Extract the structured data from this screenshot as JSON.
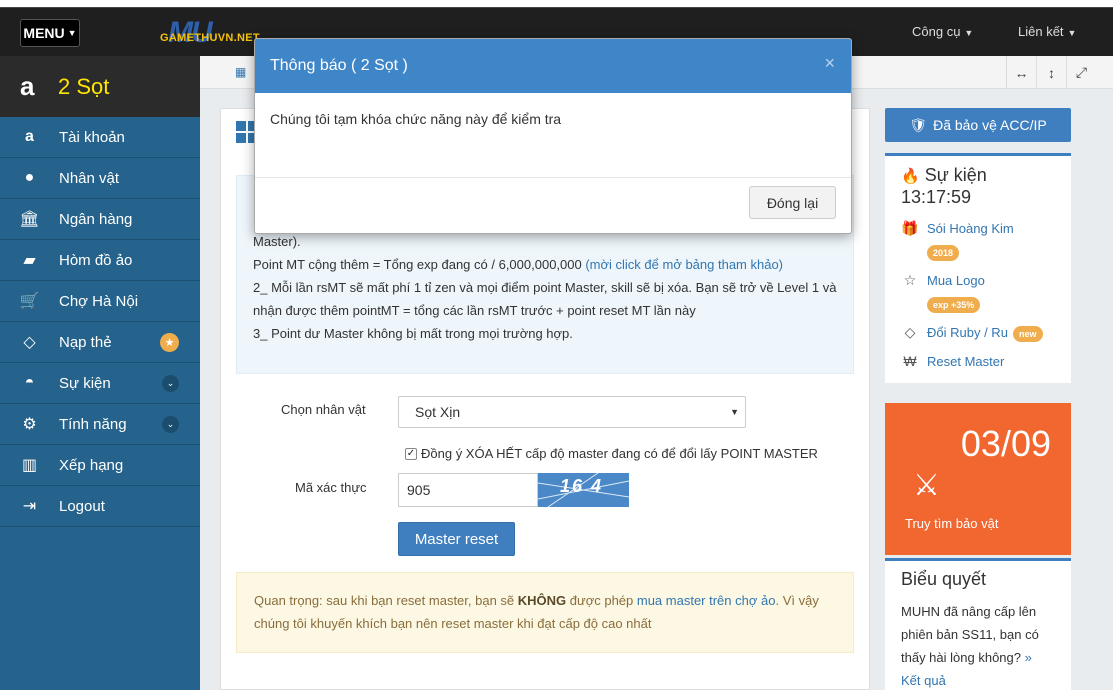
{
  "topbar": {
    "menu_label": "MENU",
    "logo_big": "MU",
    "logo_small": "GAMETHUVN.NET",
    "links": [
      {
        "label": "Công cụ"
      },
      {
        "label": "Liên kết"
      }
    ]
  },
  "sidebar": {
    "username": "2 Sọt",
    "items": [
      {
        "label": "Tài khoản",
        "icon": "amazon-icon"
      },
      {
        "label": "Nhân vật",
        "icon": "user-icon"
      },
      {
        "label": "Ngân hàng",
        "icon": "bank-icon"
      },
      {
        "label": "Hòm đồ ảo",
        "icon": "briefcase-icon"
      },
      {
        "label": "Chợ Hà Nội",
        "icon": "cart-icon"
      },
      {
        "label": "Nạp thẻ",
        "icon": "diamond-icon"
      },
      {
        "label": "Sự kiện",
        "icon": "android-icon"
      },
      {
        "label": "Tính năng",
        "icon": "gears-icon"
      },
      {
        "label": "Xếp hạng",
        "icon": "bar-chart-icon"
      },
      {
        "label": "Logout",
        "icon": "logout-icon"
      }
    ]
  },
  "main": {
    "info": {
      "line1": "Master).",
      "line2_text": "Point MT cộng thêm = Tổng exp đang có / 6,000,000,000 ",
      "line2_link": "(mời click để mở bảng tham khảo)",
      "line3": "2_ Mỗi lần rsMT sẽ mất phí 1 tỉ zen và mọi điểm point Master, skill sẽ bị xóa. Bạn sẽ trở về Level 1 và nhận được thêm pointMT = tổng các lần rsMT trước + point reset MT lần này",
      "line4": "3_ Point dư Master không bị mất trong mọi trường hợp."
    },
    "form": {
      "char_label": "Chọn nhân vật",
      "char_value": "Sọt Xịn",
      "agree_text": "Đồng ý XÓA HẾT cấp độ master đang có để đổi lấy POINT MASTER",
      "captcha_label": "Mã xác thực",
      "captcha_value": "905",
      "captcha_image_text": "16 4",
      "submit_label": "Master reset"
    },
    "warning": {
      "part1": "Quan trọng: sau khi bạn reset master, bạn sẽ ",
      "bold": "KHÔNG",
      "part2": " được phép ",
      "link": "mua master trên chợ ảo",
      "part3": ". Vì vậy chúng tôi khuyến khích bạn nên reset master khi đạt cấp độ cao nhất"
    }
  },
  "right": {
    "protect_label": "Đã bảo vệ ACC/IP",
    "events_title": "Sự kiện",
    "events_time": "13:17:59",
    "events": [
      {
        "label": "Sói Hoàng Kim",
        "badge": "2018"
      },
      {
        "label": "Mua Logo",
        "badge": "exp +35%"
      },
      {
        "label": "Đổi Ruby / Ru",
        "badge": "new"
      },
      {
        "label": "Reset Master",
        "badge": ""
      }
    ],
    "treasure_date": "03/09",
    "treasure_caption": "Truy tìm bảo vật",
    "poll_title": "Biểu quyết",
    "poll_text": "MUHN đã nâng cấp lên phiên bản SS11, bạn có thấy hài lòng không?",
    "poll_link": "»",
    "poll_result": "Kết quả"
  },
  "modal": {
    "title": "Thông báo ( 2 Sọt )",
    "close_x": "×",
    "message": "Chúng tôi tạm khóa chức năng này để kiểm tra",
    "close_label": "Đóng lại"
  }
}
